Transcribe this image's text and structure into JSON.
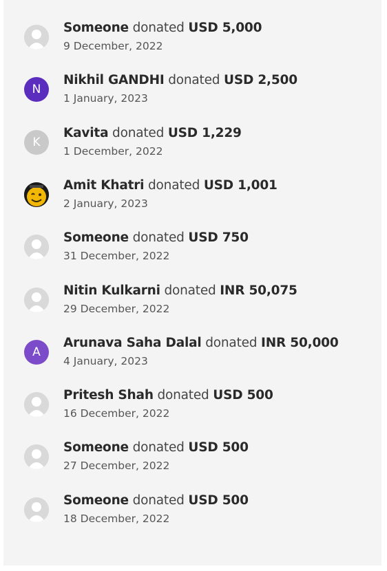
{
  "donations": [
    {
      "name": "Someone",
      "verb": "donated",
      "amount": "USD 5,000",
      "date": "9 December, 2022",
      "avatar": {
        "type": "default-user-icon",
        "color": "#d9d9d9"
      }
    },
    {
      "name": "Nikhil GANDHI",
      "verb": "donated",
      "amount": "USD 2,500",
      "date": "1 January, 2023",
      "avatar": {
        "type": "letter",
        "letter": "N",
        "color": "#5b2dbf"
      }
    },
    {
      "name": "Kavita",
      "verb": "donated",
      "amount": "USD 1,229",
      "date": "1 December, 2022",
      "avatar": {
        "type": "letter",
        "letter": "K",
        "color": "#c9c9c9"
      }
    },
    {
      "name": "Amit Khatri",
      "verb": "donated",
      "amount": "USD 1,001",
      "date": "2 January, 2023",
      "avatar": {
        "type": "smiley-photo",
        "color": "#f2b705"
      }
    },
    {
      "name": "Someone",
      "verb": "donated",
      "amount": "USD 750",
      "date": "31 December, 2022",
      "avatar": {
        "type": "default-user-icon",
        "color": "#d9d9d9"
      }
    },
    {
      "name": "Nitin Kulkarni",
      "verb": "donated",
      "amount": "INR 50,075",
      "date": "29 December, 2022",
      "avatar": {
        "type": "default-user-icon",
        "color": "#d9d9d9"
      }
    },
    {
      "name": "Arunava Saha Dalal",
      "verb": "donated",
      "amount": "INR 50,000",
      "date": "4 January, 2023",
      "avatar": {
        "type": "letter",
        "letter": "A",
        "color": "#7b4bc9"
      }
    },
    {
      "name": "Pritesh Shah",
      "verb": "donated",
      "amount": "USD 500",
      "date": "16 December, 2022",
      "avatar": {
        "type": "default-user-icon",
        "color": "#d9d9d9"
      }
    },
    {
      "name": "Someone",
      "verb": "donated",
      "amount": "USD 500",
      "date": "27 December, 2022",
      "avatar": {
        "type": "default-user-icon",
        "color": "#d9d9d9"
      }
    },
    {
      "name": "Someone",
      "verb": "donated",
      "amount": "USD 500",
      "date": "18 December, 2022",
      "avatar": {
        "type": "default-user-icon",
        "color": "#d9d9d9"
      }
    }
  ]
}
